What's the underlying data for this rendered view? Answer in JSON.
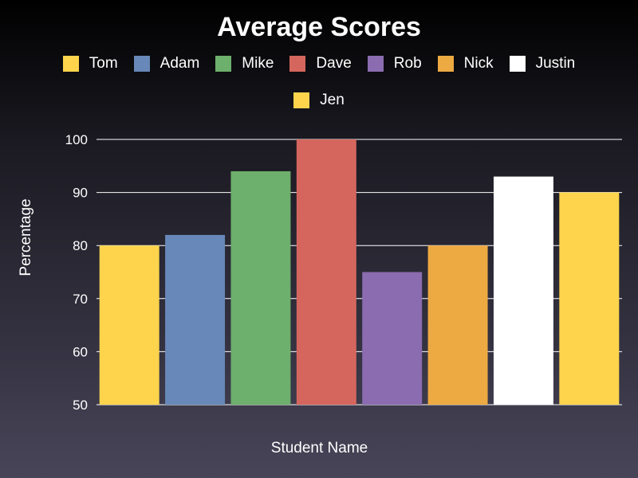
{
  "chart_data": {
    "type": "bar",
    "title": "Average Scores",
    "xlabel": "Student Name",
    "ylabel": "Percentage",
    "ylim": [
      50,
      100
    ],
    "yticks": [
      "50",
      "60",
      "70",
      "80",
      "90",
      "100"
    ],
    "ytick_values": [
      50,
      60,
      70,
      80,
      90,
      100
    ],
    "grid": true,
    "legend_position": "top",
    "categories": [
      "Tom",
      "Adam",
      "Mike",
      "Dave",
      "Rob",
      "Nick",
      "Justin",
      "Jen"
    ],
    "values": [
      80,
      82,
      94,
      100,
      75,
      80,
      93,
      90
    ],
    "colors": [
      "#fdd44c",
      "#6788b8",
      "#6daf6c",
      "#d5665e",
      "#8b6cb0",
      "#eda942",
      "#ffffff",
      "#fdd44c"
    ]
  }
}
